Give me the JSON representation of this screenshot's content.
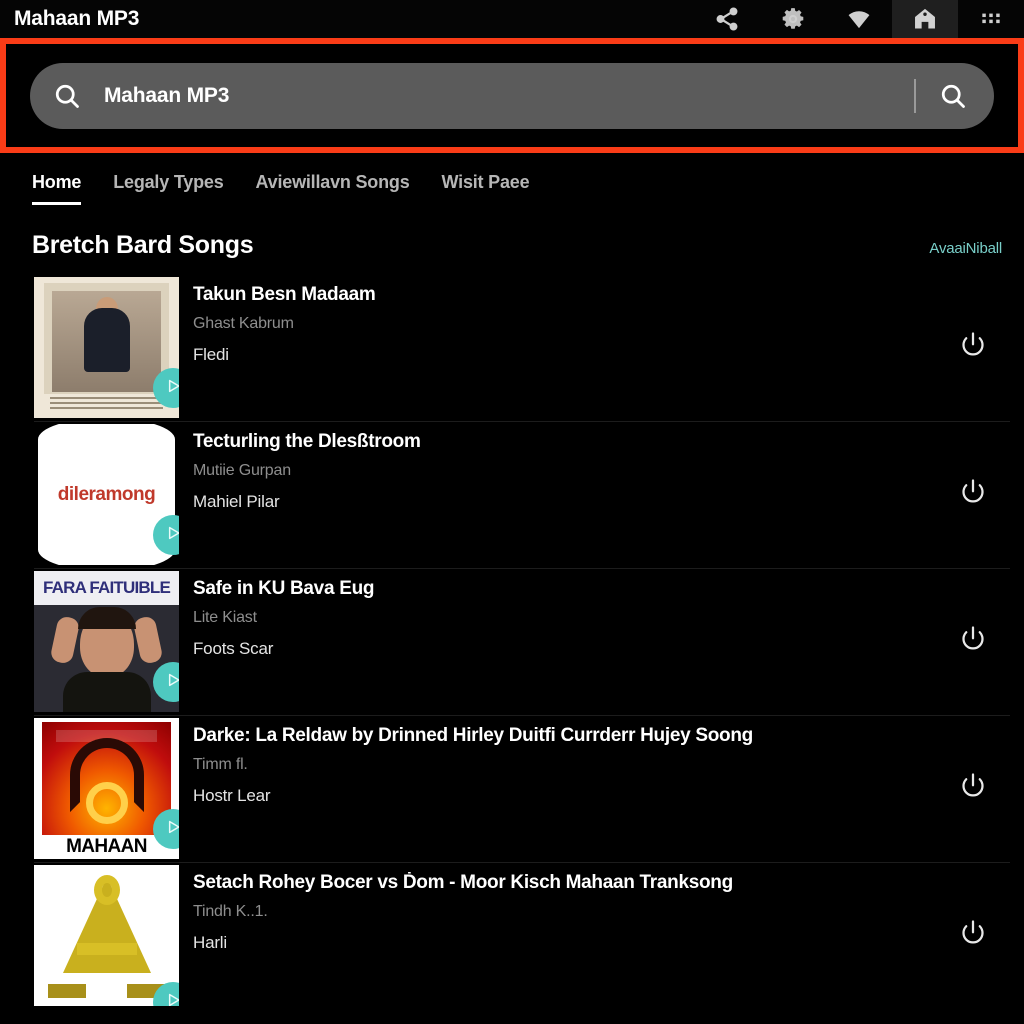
{
  "topbar": {
    "title": "Mahaan MP3",
    "icons": [
      {
        "name": "share-icon",
        "label": "Share"
      },
      {
        "name": "gear-icon",
        "label": "Settings"
      },
      {
        "name": "wifi-icon",
        "label": "Wifi"
      },
      {
        "name": "home-icon",
        "label": "Home",
        "selected": true
      },
      {
        "name": "apps-grid-icon",
        "label": "Apps"
      }
    ]
  },
  "search": {
    "value": "Mahaan MP3",
    "placeholder": "Mahaan MP3",
    "highlight_color": "#fa3c17",
    "field_color": "#5b5b5b",
    "search_icon": "search-icon",
    "submit_icon": "search-icon"
  },
  "tabs": [
    {
      "label": "Home",
      "active": true
    },
    {
      "label": "Legaly Types",
      "active": false
    },
    {
      "label": "Aviewillavn Songs",
      "active": false
    },
    {
      "label": "Wisit Paee",
      "active": false
    }
  ],
  "section": {
    "title": "Bretch Bard Songs",
    "action_label": "AvaaiNiball",
    "action_color": "#79cfc9"
  },
  "songs": [
    {
      "title": "Takun Besn Madaam",
      "subtitle": "Ghast Kabrum",
      "extra": "Fledi",
      "art": "art-a",
      "art_text": "",
      "play_icon": "play-icon",
      "action_icon": "power-icon"
    },
    {
      "title": "Tecturling the Dlesßtroom",
      "subtitle": "Mutiie Gurpan",
      "extra": "Mahiel Pilar",
      "art": "art-b",
      "art_text": "dileramong",
      "play_icon": "play-icon",
      "action_icon": "power-icon"
    },
    {
      "title": "Safe in KU Bava Eug",
      "subtitle": "Lite Kiast",
      "extra": "Foots Scar",
      "art": "art-c",
      "art_text": "FARA FAITUIBLE",
      "play_icon": "play-icon",
      "action_icon": "power-icon"
    },
    {
      "title": "Darke: La Reldaw by Drinned Hirley Duitfi Currderr Hujey Soong",
      "subtitle": "Timm fl.",
      "extra": "Hostr Lear",
      "art": "art-d",
      "art_text": "MAHAAN",
      "play_icon": "play-icon",
      "action_icon": "power-icon"
    },
    {
      "title": "Setach Rohey Bocer vs Ḋom - Moor Kisch Mahaan Tranksong",
      "subtitle": "Tindh K..1.",
      "extra": "Harli",
      "art": "art-e",
      "art_text": "",
      "play_icon": "play-icon",
      "action_icon": "power-icon"
    }
  ]
}
